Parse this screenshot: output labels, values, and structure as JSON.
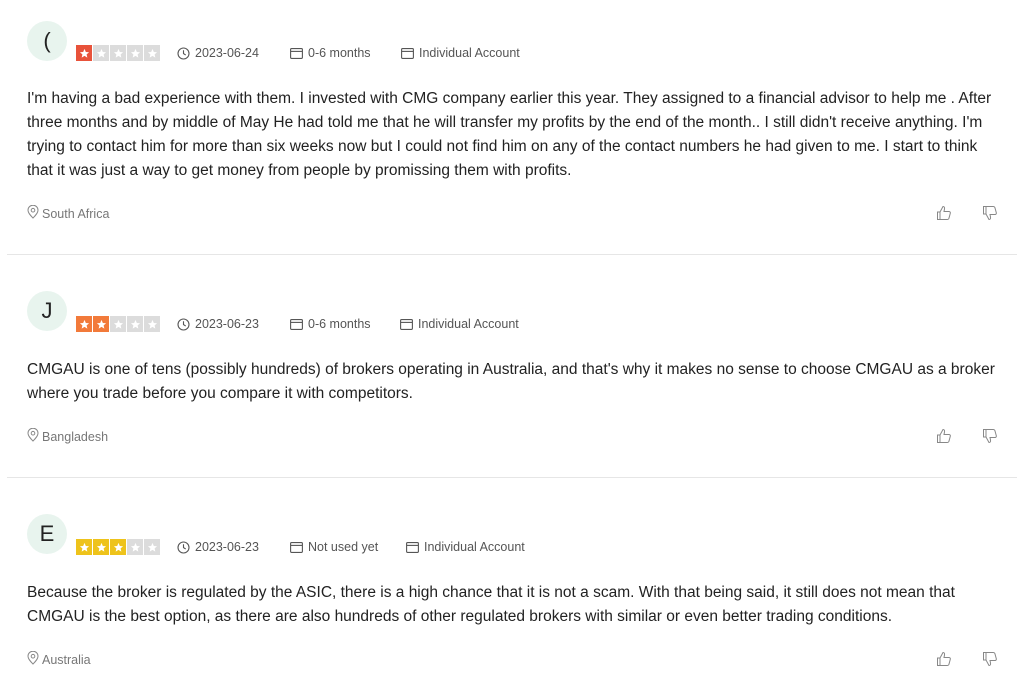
{
  "colors": {
    "star_red": "#e8523a",
    "star_orange": "#f27a3a",
    "star_yellow": "#eec31b",
    "star_empty": "#dcdcdc",
    "avatar_bg": "#e8f4ee"
  },
  "icons": {
    "date": "clock-icon",
    "duration": "card-icon",
    "account": "card-icon",
    "location": "location-pin-icon",
    "like": "thumbs-up-icon",
    "dislike": "thumbs-down-icon"
  },
  "reviews": [
    {
      "initial": "(",
      "rating": 1,
      "date": "2023-06-24",
      "duration": "0-6 months",
      "account": "Individual Account",
      "text": "I'm having a bad experience with them. I invested with CMG company earlier this year. They assigned to a financial advisor to help me . After three months and by middle of May He had told me that he will transfer my profits by the end of the month.. I still didn't receive anything. I'm trying to contact him for more than six weeks now but I could not find him on any of the contact numbers he had given to me. I start to think that it was just a way to get money from people by promissing them with profits.",
      "location": "South Africa"
    },
    {
      "initial": "J",
      "rating": 2,
      "date": "2023-06-23",
      "duration": "0-6 months",
      "account": "Individual Account",
      "text": "CMGAU is one of tens (possibly hundreds) of brokers operating in Australia, and that's why it makes no sense to choose CMGAU as a broker where you trade before you compare it with competitors.",
      "location": "Bangladesh"
    },
    {
      "initial": "E",
      "rating": 3,
      "date": "2023-06-23",
      "duration": "Not used yet",
      "account": "Individual Account",
      "text": "Because the broker is regulated by the ASIC, there is a high chance that it is not a scam. With that being said, it still does not mean that CMGAU is the best option, as there are also hundreds of other regulated brokers with similar or even better trading conditions.",
      "location": "Australia"
    }
  ]
}
